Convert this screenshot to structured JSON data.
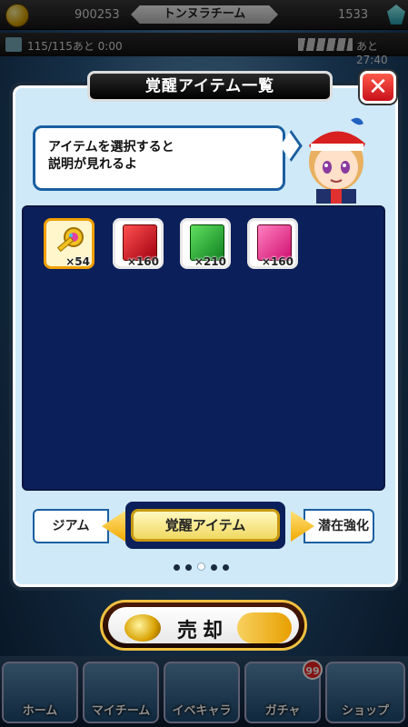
{
  "status": {
    "coins": "900253",
    "team_name": "トンヌラチーム",
    "points": "1533",
    "stamina": "115/115あと 0:00",
    "timer": "あと27:40"
  },
  "dialog": {
    "title": "覚醒アイテム一覧",
    "hint": "アイテムを選択すると\n説明が見れるよ"
  },
  "items": [
    {
      "icon": "rainbow-key-icon",
      "count": "×54"
    },
    {
      "icon": "red-book-icon",
      "count": "×160"
    },
    {
      "icon": "green-book-icon",
      "count": "×210"
    },
    {
      "icon": "pink-book-icon",
      "count": "×160"
    }
  ],
  "tabs": {
    "prev": "ジアム",
    "current": "覚醒アイテム",
    "next": "潜在強化"
  },
  "pager": {
    "total": 5,
    "active": 2
  },
  "sell_button": "売却",
  "bottom_nav": [
    {
      "label": "ホーム"
    },
    {
      "label": "マイチーム"
    },
    {
      "label": "イベキャラ"
    },
    {
      "label": "ガチャ",
      "badge": "99"
    },
    {
      "label": "ショップ"
    }
  ]
}
